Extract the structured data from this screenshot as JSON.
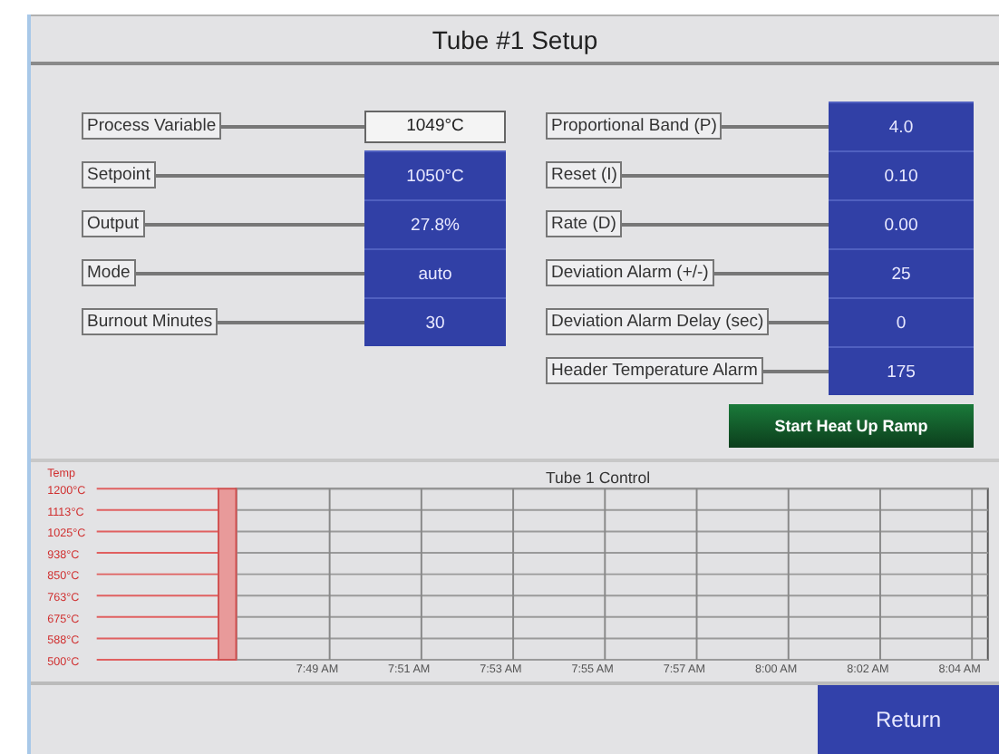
{
  "title": "Tube #1 Setup",
  "left_fields": [
    {
      "label": "Process Variable",
      "value": "1049°C",
      "kind": "display"
    },
    {
      "label": "Setpoint",
      "value": "1050°C",
      "kind": "input"
    },
    {
      "label": "Output",
      "value": "27.8%",
      "kind": "input"
    },
    {
      "label": "Mode",
      "value": "auto",
      "kind": "input"
    },
    {
      "label": "Burnout Minutes",
      "value": "30",
      "kind": "input"
    }
  ],
  "right_fields": [
    {
      "label": "Proportional Band (P)",
      "value": "4.0",
      "kind": "input"
    },
    {
      "label": "Reset (I)",
      "value": "0.10",
      "kind": "input"
    },
    {
      "label": "Rate (D)",
      "value": "0.00",
      "kind": "input"
    },
    {
      "label": "Deviation Alarm (+/-)",
      "value": "25",
      "kind": "input"
    },
    {
      "label": "Deviation Alarm Delay (sec)",
      "value": "0",
      "kind": "input"
    },
    {
      "label": "Header Temperature Alarm",
      "value": "175",
      "kind": "input"
    }
  ],
  "start_button": "Start Heat Up Ramp",
  "trend": {
    "title": "Tube 1  Control",
    "y_label": "Temp",
    "y_ticks": [
      "1200°C",
      "1113°C",
      "1025°C",
      "938°C",
      "850°C",
      "763°C",
      "675°C",
      "588°C",
      "500°C"
    ],
    "x_ticks": [
      "7:49 AM",
      "7:51 AM",
      "7:53 AM",
      "7:55 AM",
      "7:57 AM",
      "8:00 AM",
      "8:02 AM",
      "8:04 AM"
    ]
  },
  "return_button": "Return"
}
